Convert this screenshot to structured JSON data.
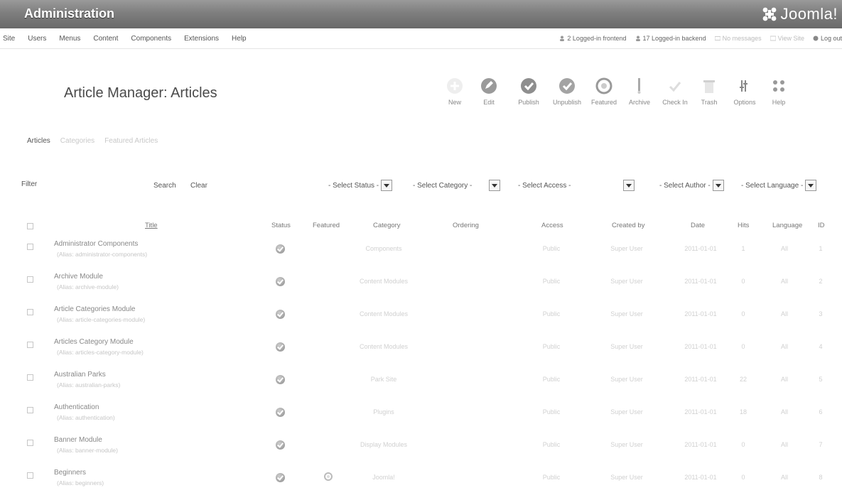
{
  "header": {
    "admin_title": "Administration",
    "logo_text": "Joomla!"
  },
  "menu": {
    "items": [
      "Site",
      "Users",
      "Menus",
      "Content",
      "Components",
      "Extensions",
      "Help"
    ]
  },
  "status": {
    "frontend": "2 Logged-in frontend",
    "backend": "17 Logged-in backend",
    "messages": "No messages",
    "view_site": "View Site",
    "logout": "Log out"
  },
  "page": {
    "title": "Article Manager: Articles"
  },
  "toolbar": {
    "buttons": [
      {
        "label": "New",
        "icon": "new-icon"
      },
      {
        "label": "Edit",
        "icon": "edit-icon"
      },
      {
        "label": "Publish",
        "icon": "publish-icon"
      },
      {
        "label": "Unpublish",
        "icon": "unpublish-icon"
      },
      {
        "label": "Featured",
        "icon": "featured-icon"
      },
      {
        "label": "Archive",
        "icon": "archive-icon"
      },
      {
        "label": "Check In",
        "icon": "checkin-icon"
      },
      {
        "label": "Trash",
        "icon": "trash-icon"
      },
      {
        "label": "Options",
        "icon": "options-icon"
      },
      {
        "label": "Help",
        "icon": "help-icon"
      }
    ]
  },
  "subnav": {
    "items": [
      "Articles",
      "Categories",
      "Featured Articles"
    ]
  },
  "filter": {
    "label": "Filter",
    "search": "Search",
    "clear": "Clear",
    "status": "- Select Status -",
    "category": "- Select Category -",
    "access": "- Select Access -",
    "author": "- Select Author -",
    "language": "- Select Language -"
  },
  "table": {
    "columns": {
      "title": "Title",
      "status": "Status",
      "featured": "Featured",
      "category": "Category",
      "ordering": "Ordering",
      "access": "Access",
      "created_by": "Created by",
      "date": "Date",
      "hits": "Hits",
      "language": "Language",
      "id": "ID"
    },
    "rows": [
      {
        "title": "Administrator Components",
        "alias": "(Alias: administrator-components)",
        "category": "Components",
        "access": "Public",
        "created_by": "Super User",
        "date": "2011-01-01",
        "hits": "1",
        "language": "All",
        "id": "1",
        "featured": false
      },
      {
        "title": "Archive Module",
        "alias": "(Alias: archive-module)",
        "category": "Content Modules",
        "access": "Public",
        "created_by": "Super User",
        "date": "2011-01-01",
        "hits": "0",
        "language": "All",
        "id": "2",
        "featured": false
      },
      {
        "title": "Article Categories Module",
        "alias": "(Alias: article-categories-module)",
        "category": "Content Modules",
        "access": "Public",
        "created_by": "Super User",
        "date": "2011-01-01",
        "hits": "0",
        "language": "All",
        "id": "3",
        "featured": false
      },
      {
        "title": "Articles Category Module",
        "alias": "(Alias: articles-category-module)",
        "category": "Content Modules",
        "access": "Public",
        "created_by": "Super User",
        "date": "2011-01-01",
        "hits": "0",
        "language": "All",
        "id": "4",
        "featured": false
      },
      {
        "title": "Australian Parks",
        "alias": "(Alias: australian-parks)",
        "category": "Park Site",
        "access": "Public",
        "created_by": "Super User",
        "date": "2011-01-01",
        "hits": "22",
        "language": "All",
        "id": "5",
        "featured": false
      },
      {
        "title": "Authentication",
        "alias": "(Alias: authentication)",
        "category": "Plugins",
        "access": "Public",
        "created_by": "Super User",
        "date": "2011-01-01",
        "hits": "18",
        "language": "All",
        "id": "6",
        "featured": false
      },
      {
        "title": "Banner Module",
        "alias": "(Alias: banner-module)",
        "category": "Display Modules",
        "access": "Public",
        "created_by": "Super User",
        "date": "2011-01-01",
        "hits": "0",
        "language": "All",
        "id": "7",
        "featured": false
      },
      {
        "title": "Beginners",
        "alias": "(Alias: beginners)",
        "category": "Joomla!",
        "access": "Public",
        "created_by": "Super User",
        "date": "2011-01-01",
        "hits": "0",
        "language": "All",
        "id": "8",
        "featured": true
      }
    ]
  },
  "colors": {
    "header_bg": "#7e7e7e",
    "text": "#666666",
    "faint": "#c8c8c8"
  }
}
